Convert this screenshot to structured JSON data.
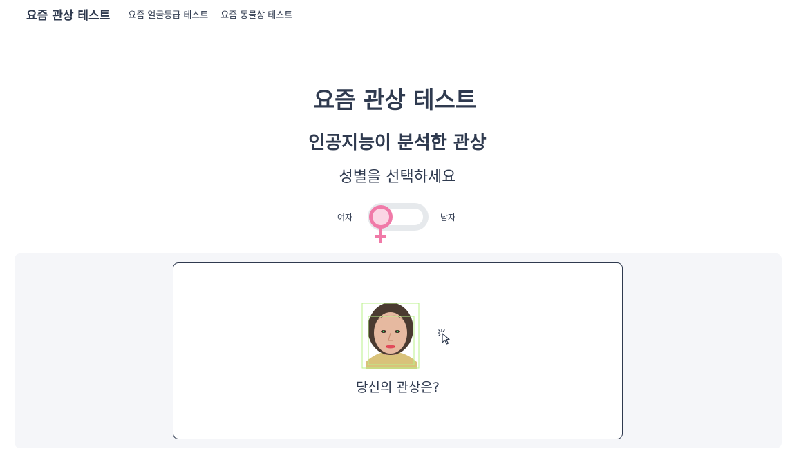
{
  "nav": {
    "brand": "요즘 관상 테스트",
    "links": [
      "요즘 얼굴등급 테스트",
      "요즘 동물상 테스트"
    ]
  },
  "hero": {
    "title": "요즘 관상 테스트",
    "subtitle": "인공지능이 분석한 관상",
    "gender_prompt": "성별을 선택하세요"
  },
  "gender_toggle": {
    "left_label": "여자",
    "right_label": "남자",
    "selected": "여자",
    "knob_icon": "female-symbol-icon",
    "knob_color": "#f07aa8",
    "track_color": "#e6e9ec"
  },
  "upload": {
    "image_icon": "sample-face-photo",
    "cursor_icon": "click-cursor-icon",
    "caption": "당신의 관상은?"
  },
  "colors": {
    "text": "#2f3a4f",
    "panel_bg": "#f5f6f9",
    "accent_pink": "#f07aa8"
  }
}
